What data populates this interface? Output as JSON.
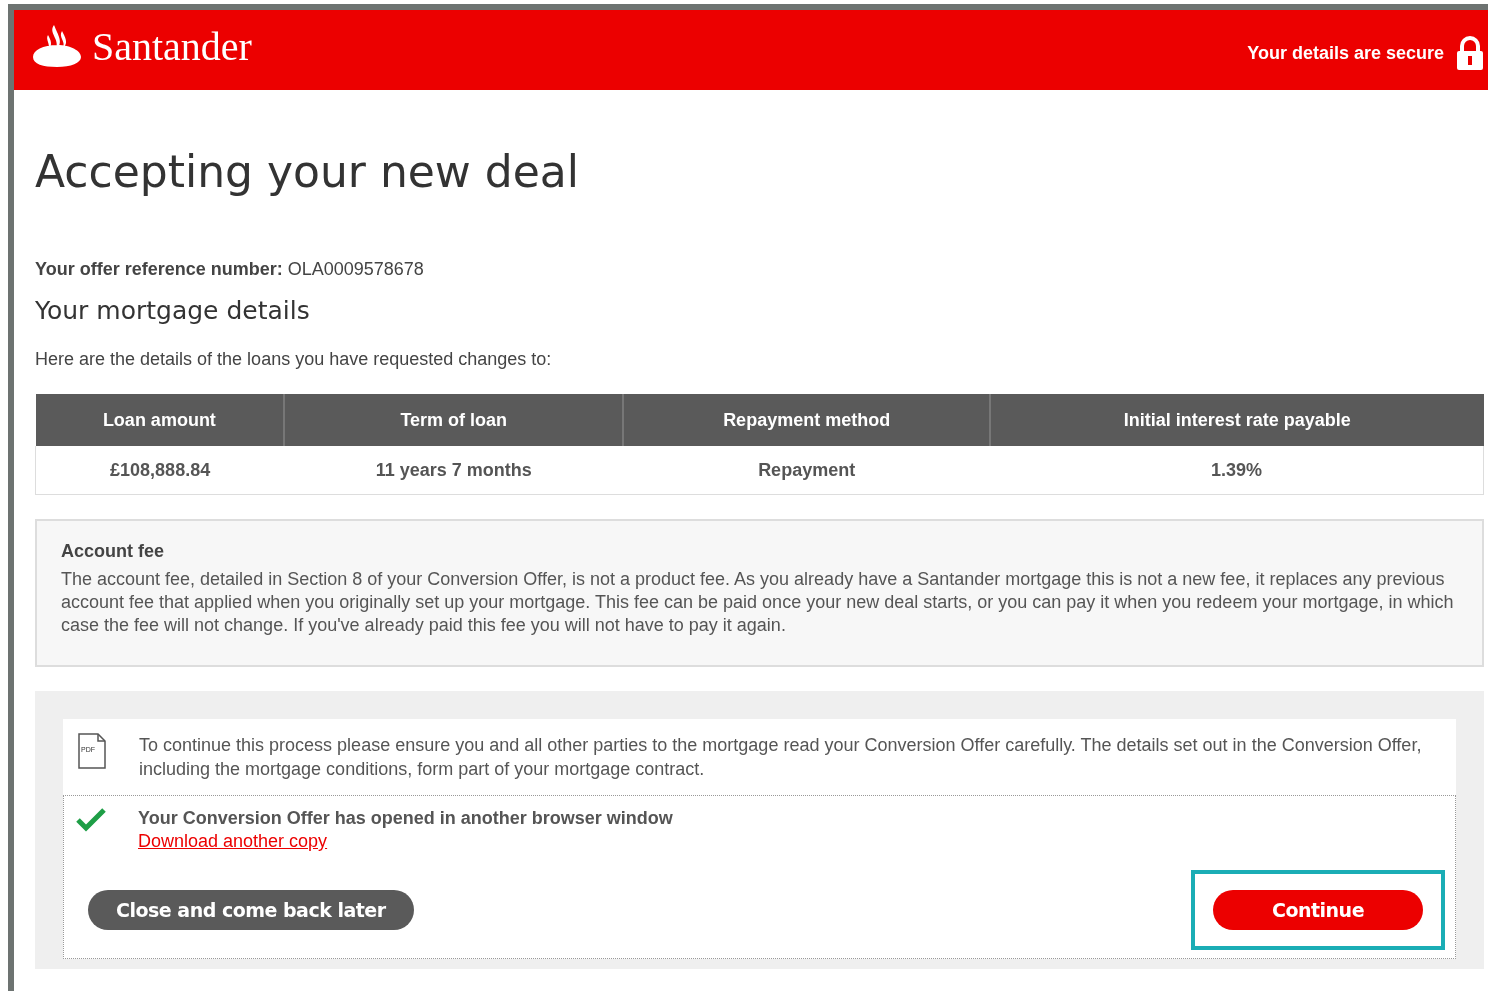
{
  "header": {
    "brand": "Santander",
    "secure_text": "Your details are secure"
  },
  "page_title": "Accepting your new deal",
  "offer_reference": {
    "label": "Your offer reference number:",
    "value": "OLA0009578678"
  },
  "section_title": "Your mortgage details",
  "intro": "Here are the details of the loans you have requested changes to:",
  "table": {
    "columns": [
      "Loan amount",
      "Term of loan",
      "Repayment method",
      "Initial interest rate payable"
    ],
    "rows": [
      [
        "£108,888.84",
        "11 years 7 months",
        "Repayment",
        "1.39%"
      ]
    ]
  },
  "account_fee": {
    "title": "Account fee",
    "text": "The account fee, detailed in Section 8 of your Conversion Offer, is not a product fee. As you already have a Santander mortgage this is not a new fee, it replaces any previous account fee that applied when you originally set up your mortgage. This fee can be paid once your new deal starts, or you can pay it when you redeem your mortgage, in which case the fee will not change. If you've already paid this fee you will not have to pay it again."
  },
  "document": {
    "pdf_label": "PDF",
    "notice": "To continue this process please ensure you and all other parties to the mortgage read your Conversion Offer carefully. The details set out in the Conversion Offer, including the mortgage conditions, form part of your mortgage contract.",
    "status": "Your Conversion Offer has opened in another browser window",
    "opened": true,
    "download_link": "Download another copy"
  },
  "buttons": [
    {
      "kind": "secondary",
      "label": "Close and come back later",
      "highlighted": false
    },
    {
      "kind": "primary",
      "label": "Continue",
      "highlighted": true
    }
  ]
}
